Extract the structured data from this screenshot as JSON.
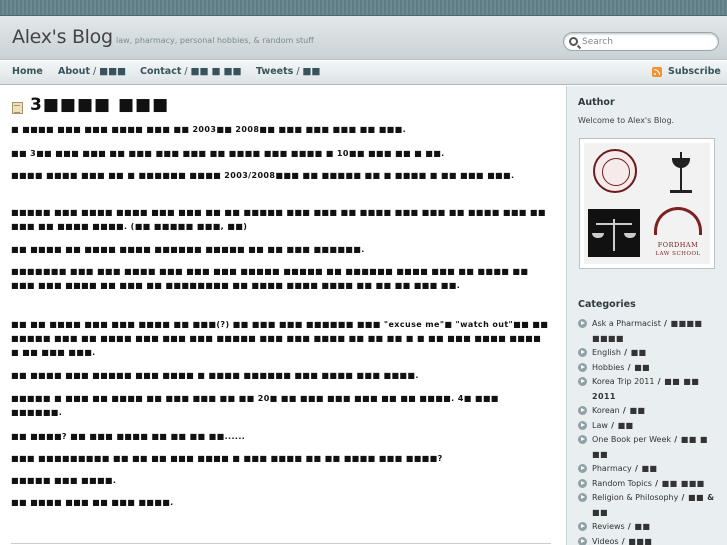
{
  "header": {
    "blog_title": "Alex's Blog",
    "tagline": "law, pharmacy, personal hobbies, & random stuff",
    "search_placeholder": "Search"
  },
  "nav": {
    "items": [
      {
        "label": "Home",
        "suffix": ""
      },
      {
        "label": "About",
        "suffix": " / ■■■"
      },
      {
        "label": "Contact",
        "suffix": " / ■■ ■ ■■"
      },
      {
        "label": "Tweets",
        "suffix": " / ■■"
      }
    ],
    "subscribe": "Subscribe",
    "subscribe_icon": "rss-icon"
  },
  "post": {
    "title": "3■■■■ ■■■",
    "paragraphs": [
      "■ ■■■■ ■■■ ■■■ ■■■■ ■■■ ■■ 2003■■ 2008■■ ■■■ ■■■ ■■■ ■■ ■■■.",
      "■■ 3■■ ■■■ ■■■ ■■ ■■■ ■■■ ■■■ ■■ ■■■■ ■■■ ■■■■ ■ 10■■ ■■■ ■■ ■ ■■.",
      "■■■■ ■■■■ ■■■ ■■ ■ ■■■■■■ ■■■■ 2003/2008■■■ ■■ ■■■■■ ■■ ■ ■■■■ ■ ■■ ■■■ ■■■.",
      "■■■■■ ■■■ ■■■■ ■■■■ ■■■ ■■■ ■■ ■■ ■■■■■ ■■■ ■■■ ■■ ■■■■ ■■■ ■■■ ■■ ■■■■ ■■■ ■■ ■■■ ■■ ■■■■ ■■■■. (■■ ■■■■■ ■■■, ■■)",
      "■■ ■■■■ ■■ ■■■■ ■■■■ ■■■■■■ ■■■■■ ■■ ■■ ■■■ ■■■■■■.",
      "■■■■■■■ ■■■ ■■■ ■■■■ ■■■ ■■■ ■■■ ■■■■■ ■■■■■ ■■ ■■■■■■ ■■■■ ■■■ ■■ ■■■■ ■■ ■■■ ■■■ ■■■■ ■■ ■■■ ■■ ■■■■■■■■ ■■ ■■■■ ■■■■ ■■■■ ■■ ■■ ■■ ■■■ ■■.",
      "■■ ■■ ■■■■ ■■■ ■■■ ■■■■ ■■ ■■■(?) ■■ ■■■ ■■■ ■■■■■■ ■■■ \"excuse me\"■ \"watch out\"■■ ■■ ■■■■■ ■■■ ■■ ■■■■ ■■■ ■■■ ■■■ ■■■■■ ■■■ ■■■ ■■■■ ■■ ■■ ■■ ■ ■ ■■ ■■■ ■■■■ ■■■■ ■ ■■ ■■■ ■■■.",
      "■■ ■■■■ ■■■ ■■■■■ ■■■ ■■■■ ■ ■■■■ ■■■■■■ ■■■ ■■■■ ■■■ ■■■■.",
      "■■■■■ ■ ■■■ ■■ ■■■■ ■■ ■■■ ■■■ ■■ ■■ 20■ ■■ ■■■ ■■■ ■■■ ■■ ■■ ■■■■. 4■ ■■■ ■■■■■■.",
      "■■ ■■■■? ■■ ■■■ ■■■■ ■■ ■■ ■■ ■■......",
      "■■■ ■■■■■■■■■ ■■ ■■ ■■ ■■■ ■■■■ ■ ■■■ ■■■■ ■■ ■■ ■■■■ ■■■ ■■■■?",
      "■■■■■ ■■■ ■■■■.",
      "■■ ■■■■ ■■■ ■■ ■■■ ■■■■."
    ]
  },
  "sidebar": {
    "author_heading": "Author",
    "author_text": "Welcome to Alex's Blog.",
    "image_label": "FORDHAM",
    "image_sublabel": "LAW SCHOOL",
    "categories_heading": "Categories",
    "categories": [
      {
        "label": "Ask a Pharmacist",
        "suffix": " / ■■■■ ■■■■"
      },
      {
        "label": "English",
        "suffix": " / ■■"
      },
      {
        "label": "Hobbies",
        "suffix": " / ■■"
      },
      {
        "label": "Korea Trip 2011",
        "suffix": " / ■■ ■■ 2011"
      },
      {
        "label": "Korean",
        "suffix": " / ■■"
      },
      {
        "label": "Law",
        "suffix": " / ■■"
      },
      {
        "label": "One Book per Week",
        "suffix": " / ■■ ■ ■■"
      },
      {
        "label": "Pharmacy",
        "suffix": " / ■■"
      },
      {
        "label": "Random Topics",
        "suffix": " / ■■ ■■■"
      },
      {
        "label": "Religion & Philosophy",
        "suffix": " / ■■ & ■■"
      },
      {
        "label": "Reviews",
        "suffix": " / ■■"
      },
      {
        "label": "Videos",
        "suffix": " / ■■■"
      }
    ]
  }
}
